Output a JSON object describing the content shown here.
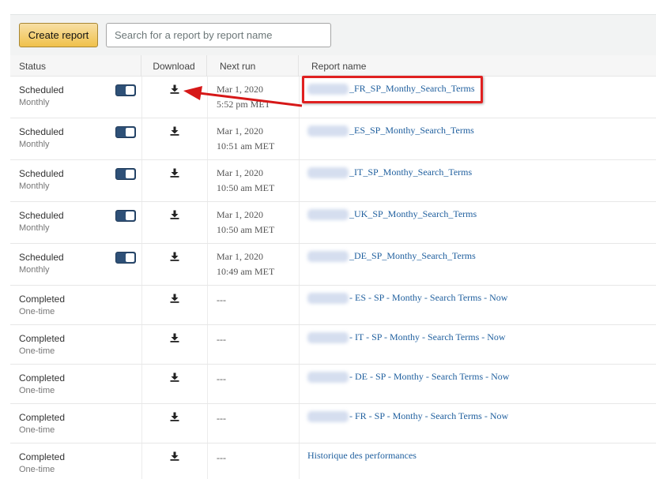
{
  "toolbar": {
    "create_label": "Create report",
    "search_placeholder": "Search for a report by report name"
  },
  "columns": {
    "status": "Status",
    "download": "Download",
    "next_run": "Next run",
    "report_name": "Report name"
  },
  "rows": [
    {
      "status": "Scheduled",
      "frequency": "Monthly",
      "toggle": true,
      "date": "Mar 1, 2020",
      "time": "5:52 pm MET",
      "name_blurred": true,
      "name": "_FR_SP_Monthy_Search_Terms"
    },
    {
      "status": "Scheduled",
      "frequency": "Monthly",
      "toggle": true,
      "date": "Mar 1, 2020",
      "time": "10:51 am MET",
      "name_blurred": true,
      "name": "_ES_SP_Monthy_Search_Terms"
    },
    {
      "status": "Scheduled",
      "frequency": "Monthly",
      "toggle": true,
      "date": "Mar 1, 2020",
      "time": "10:50 am MET",
      "name_blurred": true,
      "name": "_IT_SP_Monthy_Search_Terms"
    },
    {
      "status": "Scheduled",
      "frequency": "Monthly",
      "toggle": true,
      "date": "Mar 1, 2020",
      "time": "10:50 am MET",
      "name_blurred": true,
      "name": "_UK_SP_Monthy_Search_Terms"
    },
    {
      "status": "Scheduled",
      "frequency": "Monthly",
      "toggle": true,
      "date": "Mar 1, 2020",
      "time": "10:49 am MET",
      "name_blurred": true,
      "name": "_DE_SP_Monthy_Search_Terms"
    },
    {
      "status": "Completed",
      "frequency": "One-time",
      "toggle": false,
      "date": "---",
      "time": "",
      "name_blurred": true,
      "name": " - ES - SP - Monthy - Search Terms - Now"
    },
    {
      "status": "Completed",
      "frequency": "One-time",
      "toggle": false,
      "date": "---",
      "time": "",
      "name_blurred": true,
      "name": " - IT - SP - Monthy - Search Terms - Now"
    },
    {
      "status": "Completed",
      "frequency": "One-time",
      "toggle": false,
      "date": "---",
      "time": "",
      "name_blurred": true,
      "name": " - DE - SP - Monthy - Search Terms - Now"
    },
    {
      "status": "Completed",
      "frequency": "One-time",
      "toggle": false,
      "date": "---",
      "time": "",
      "name_blurred": true,
      "name": " - FR - SP - Monthy - Search Terms - Now"
    },
    {
      "status": "Completed",
      "frequency": "One-time",
      "toggle": false,
      "date": "---",
      "time": "",
      "name_blurred": false,
      "name": "Historique des performances"
    }
  ],
  "icons": {
    "download": "download-icon",
    "toggle": "toggle-switch",
    "annotation_arrow": "red-arrow"
  },
  "colors": {
    "accent": "#f0c14b",
    "link": "#1f5f9e",
    "toggle_on": "#2e5077",
    "annotation": "#e02020"
  }
}
